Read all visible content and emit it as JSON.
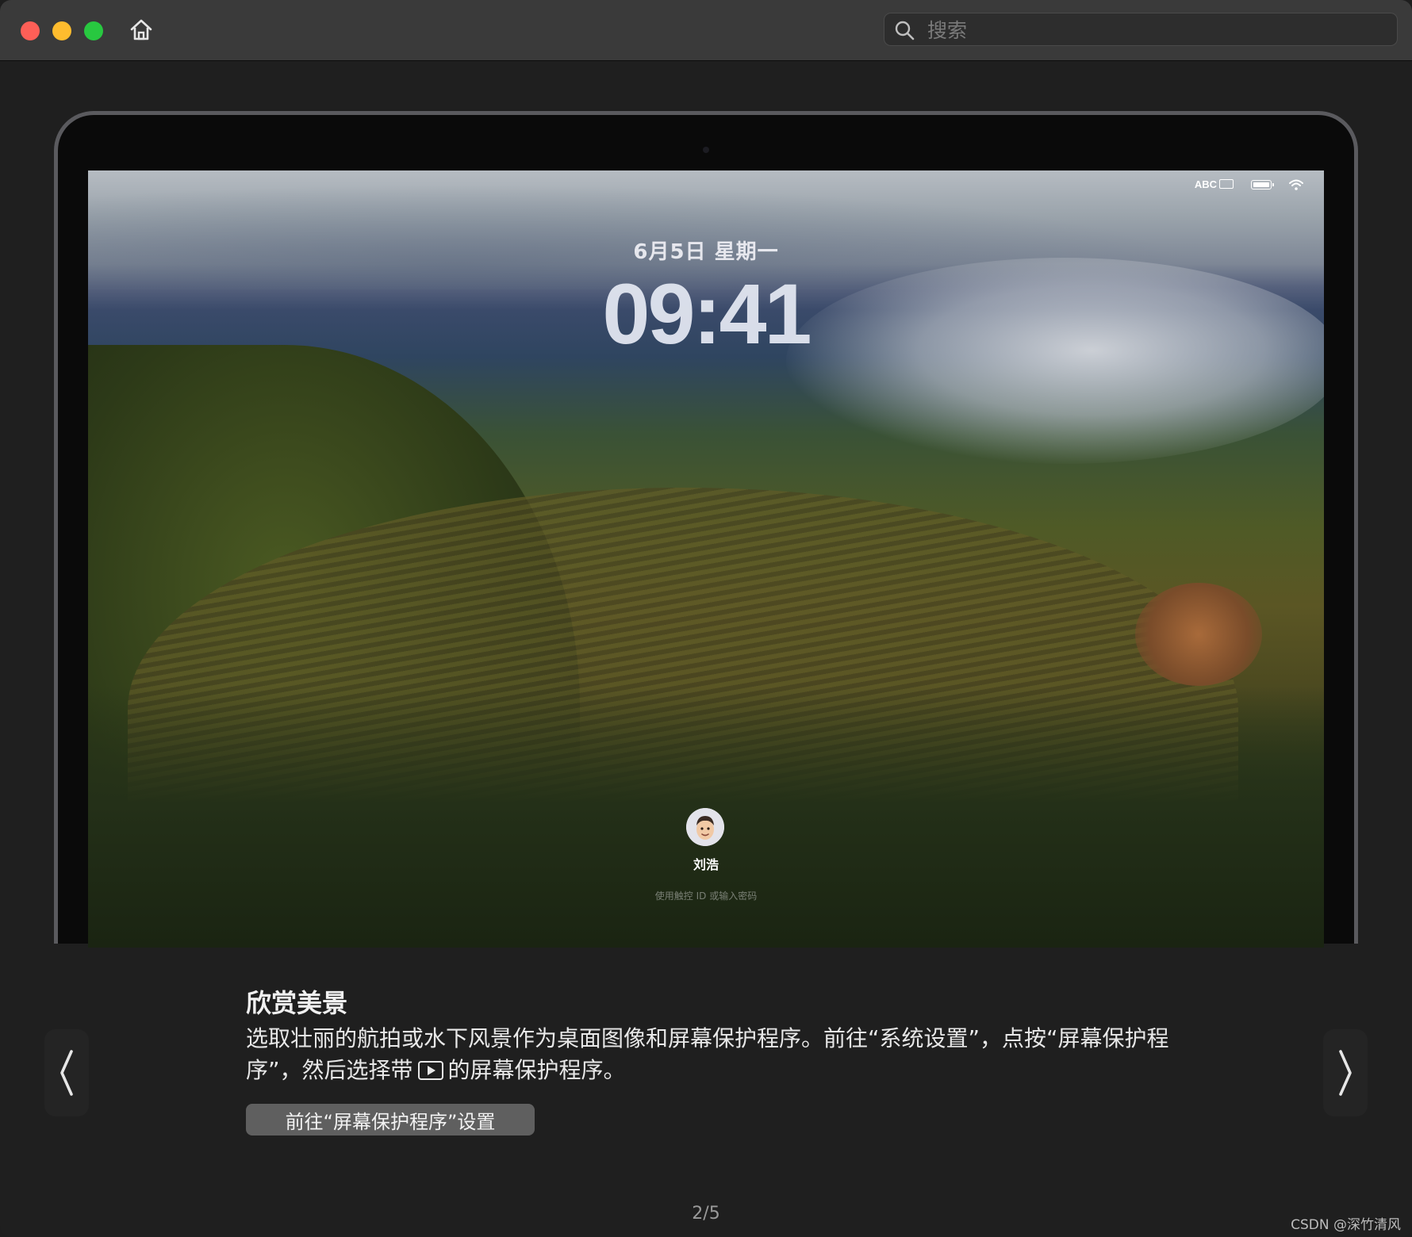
{
  "window": {
    "search_placeholder": "搜索"
  },
  "lockscreen": {
    "input_indicator": "ABC",
    "date": "6月5日 星期一",
    "time": "09:41",
    "user_name": "刘浩",
    "login_hint": "使用触控 ID 或输入密码"
  },
  "caption": {
    "title": "欣赏美景",
    "body_part1": "选取壮丽的航拍或水下风景作为桌面图像和屏幕保护程序。前往“系统设置”，点按“屏幕保护程序”，然后选择带",
    "body_part2": "的屏幕保护程序。",
    "button_label": "前往“屏幕保护程序”设置"
  },
  "pagination": {
    "indicator": "2/5"
  },
  "watermark": "CSDN @深竹清风",
  "colors": {
    "traffic_red": "#fe5f57",
    "traffic_yellow": "#febc2e",
    "traffic_green": "#28c840",
    "window_bg": "#1f1f1f",
    "button_bg": "#5f5f5f"
  },
  "icons": {
    "home": "home-icon",
    "search": "search-icon",
    "prev": "chevron-left-icon",
    "next": "chevron-right-icon",
    "play": "play-box-icon"
  }
}
